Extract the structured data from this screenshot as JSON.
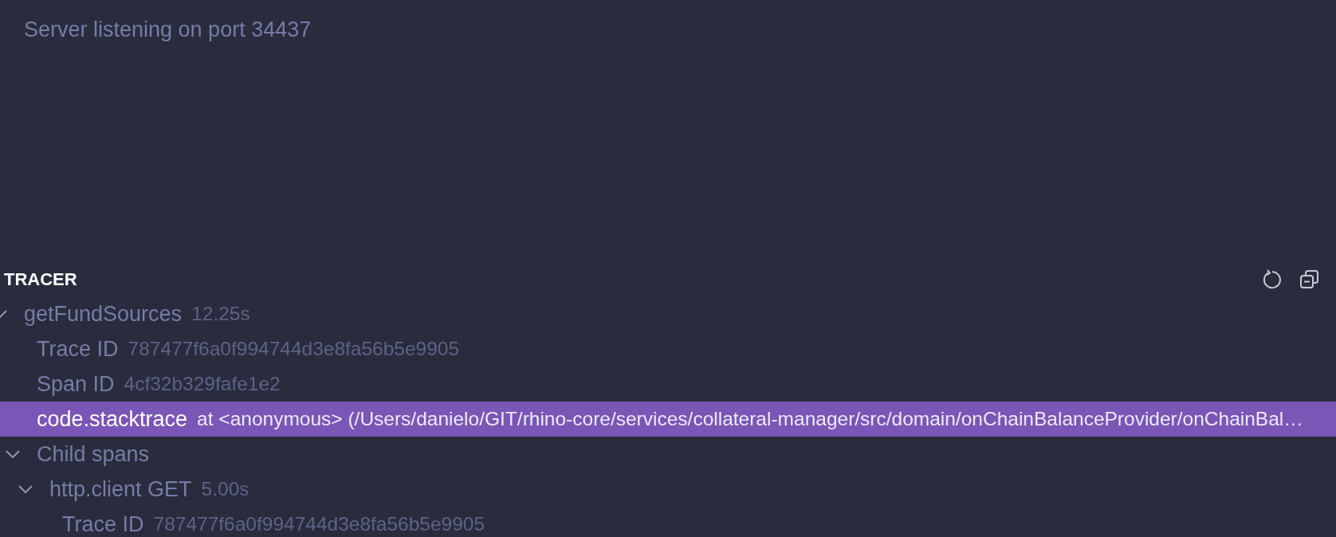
{
  "clients": {
    "message": "Server listening on port 34437"
  },
  "tracer": {
    "title": "TRACER",
    "actions": [
      {
        "kind": "refresh"
      },
      {
        "kind": "collapse"
      }
    ],
    "tree": [
      {
        "kind": "span",
        "name": "getFundSources",
        "duration": "12.25s",
        "expanded": true,
        "selected": false,
        "children": [
          {
            "kind": "attribute",
            "key": "Trace ID",
            "value": "787477f6a0f994744d3e8fa56b5e9905",
            "selected": false
          },
          {
            "kind": "attribute",
            "key": "Span ID",
            "value": "4cf32b329fafe1e2",
            "selected": false
          },
          {
            "kind": "attribute",
            "key": "code.stacktrace",
            "value": "at <anonymous> (/Users/danielo/GIT/rhino-core/services/collateral-manager/src/domain/onChainBalanceProvider/onChainBal…",
            "selected": true
          },
          {
            "kind": "group",
            "label": "Child spans",
            "expanded": true,
            "selected": false,
            "children": [
              {
                "kind": "span",
                "name": "http.client GET",
                "duration": "5.00s",
                "expanded": true,
                "selected": false,
                "children": [
                  {
                    "kind": "attribute",
                    "key": "Trace ID",
                    "value": "787477f6a0f994744d3e8fa56b5e9905",
                    "selected": false
                  }
                ]
              }
            ]
          }
        ]
      }
    ]
  }
}
